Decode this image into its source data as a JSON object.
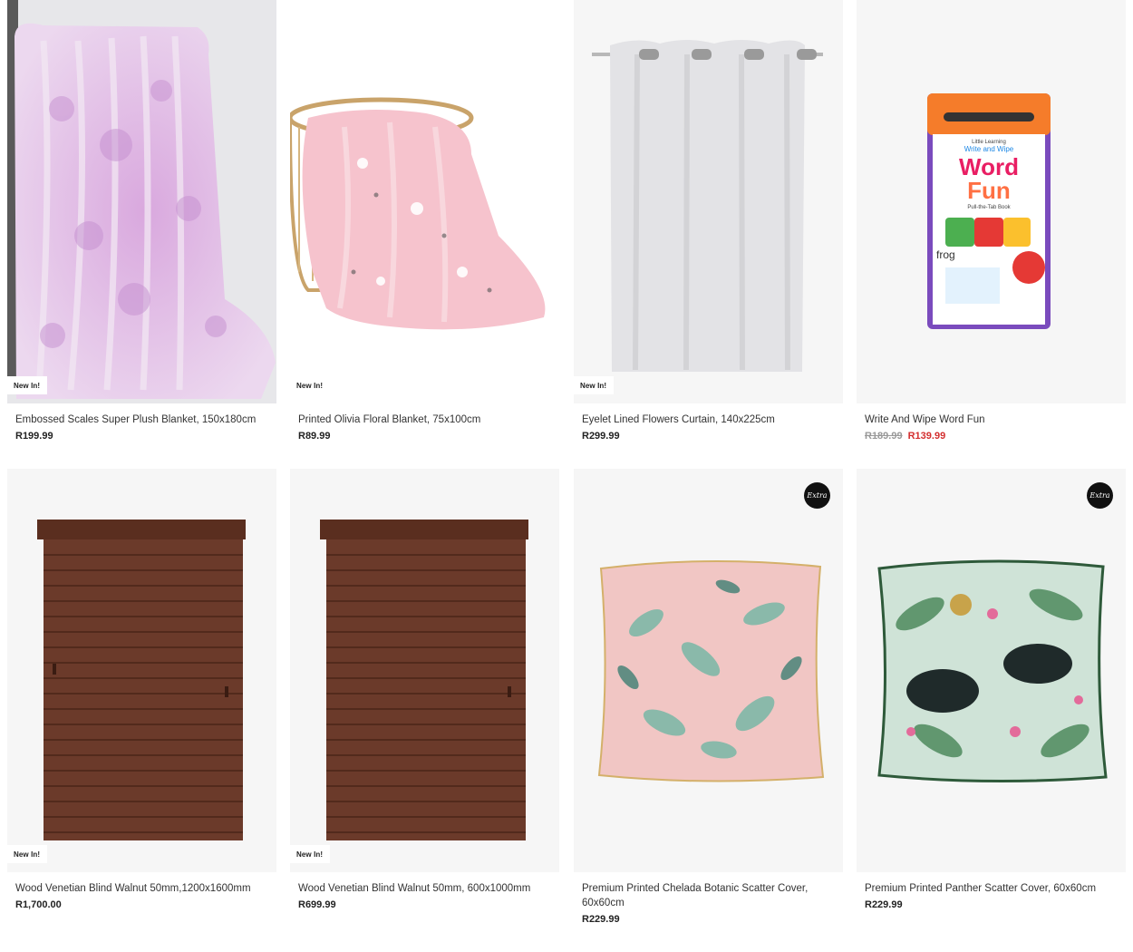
{
  "products": [
    {
      "title": "Embossed Scales Super Plush Blanket, 150x180cm",
      "price": "R199.99",
      "badge": "New In!",
      "icon": "blanket-image"
    },
    {
      "title": "Printed Olivia Floral Blanket, 75x100cm",
      "price": "R89.99",
      "badge": "New In!",
      "icon": "blanket-basket-image"
    },
    {
      "title": "Eyelet Lined Flowers Curtain, 140x225cm",
      "price": "R299.99",
      "badge": "New In!",
      "icon": "curtain-image"
    },
    {
      "title": "Write And Wipe Word Fun",
      "price_was": "R189.99",
      "price": "R139.99",
      "icon": "book-image"
    },
    {
      "title": "Wood Venetian Blind Walnut 50mm,1200x1600mm",
      "price": "R1,700.00",
      "badge": "New In!",
      "icon": "blind-image"
    },
    {
      "title": "Wood Venetian Blind Walnut 50mm, 600x1000mm",
      "price": "R699.99",
      "badge": "New In!",
      "icon": "blind-image"
    },
    {
      "title": "Premium Printed Chelada Botanic Scatter Cover, 60x60cm",
      "price": "R229.99",
      "extra_badge": "Extra",
      "icon": "cushion-image"
    },
    {
      "title": "Premium Printed Panther Scatter Cover, 60x60cm",
      "price": "R229.99",
      "extra_badge": "Extra",
      "icon": "panther-cushion-image"
    }
  ],
  "book": {
    "series": "Little Learning",
    "line1": "Write and Wipe",
    "word1": "Word",
    "word2": "Fun",
    "subtitle": "Pull-the-Tab Book",
    "sample_word": "frog"
  },
  "colors": {
    "sale_price": "#d32f2f",
    "badge_bg": "#ffffff",
    "extra_badge_bg": "#111111",
    "card_bg": "#f6f6f6"
  }
}
